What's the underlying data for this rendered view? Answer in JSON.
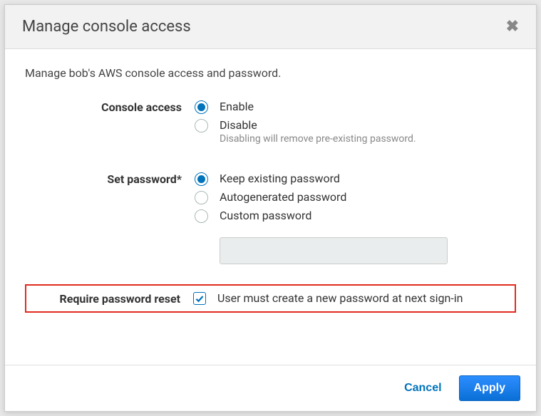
{
  "modal": {
    "title": "Manage console access",
    "subtitle": "Manage bob's AWS console access and password."
  },
  "form": {
    "console_access": {
      "label": "Console access",
      "options": {
        "enable": "Enable",
        "disable": "Disable",
        "disable_hint": "Disabling will remove pre-existing password."
      },
      "selected": "enable"
    },
    "set_password": {
      "label": "Set password*",
      "options": {
        "keep": "Keep existing password",
        "auto": "Autogenerated password",
        "custom": "Custom password"
      },
      "selected": "keep",
      "custom_value": ""
    },
    "require_reset": {
      "label": "Require password reset",
      "text": "User must create a new password at next sign-in",
      "checked": true
    }
  },
  "footer": {
    "cancel": "Cancel",
    "apply": "Apply"
  }
}
